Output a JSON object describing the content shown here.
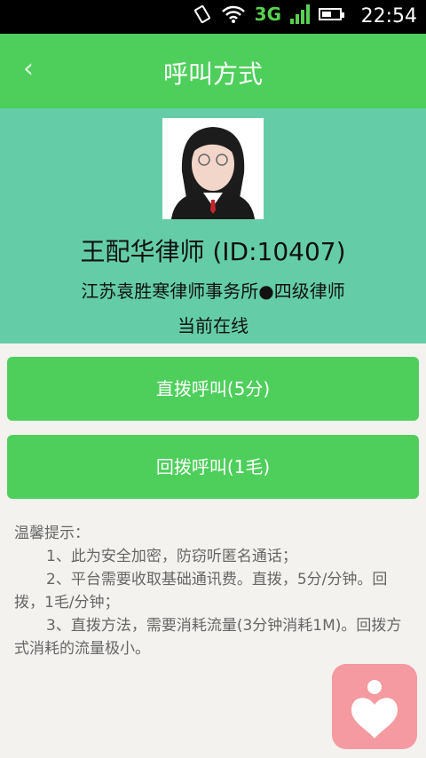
{
  "status": {
    "network": "3G",
    "time": "22:54"
  },
  "header": {
    "title": "呼叫方式",
    "back_icon": "‹"
  },
  "lawyer": {
    "name": "王配华律师 (ID:10407)",
    "firm_level": "江苏袁胜寒律师事务所●四级律师",
    "status": "当前在线"
  },
  "actions": {
    "direct_call": "直拨呼叫(5分)",
    "callback": "回拨呼叫(1毛)"
  },
  "tips": {
    "title": "温馨提示：",
    "item1": "1、此为安全加密，防窃听匿名通话；",
    "item2": "2、平台需要收取基础通讯费。直拨，5分/分钟。回拨，1毛/分钟；",
    "item3": "3、直拨方法，需要消耗流量(3分钟消耗1M)。回拨方式消耗的流量极小。"
  },
  "colors": {
    "primary": "#4ecf5b",
    "profile_bg": "#64cda8",
    "fab": "#f49aa0"
  }
}
